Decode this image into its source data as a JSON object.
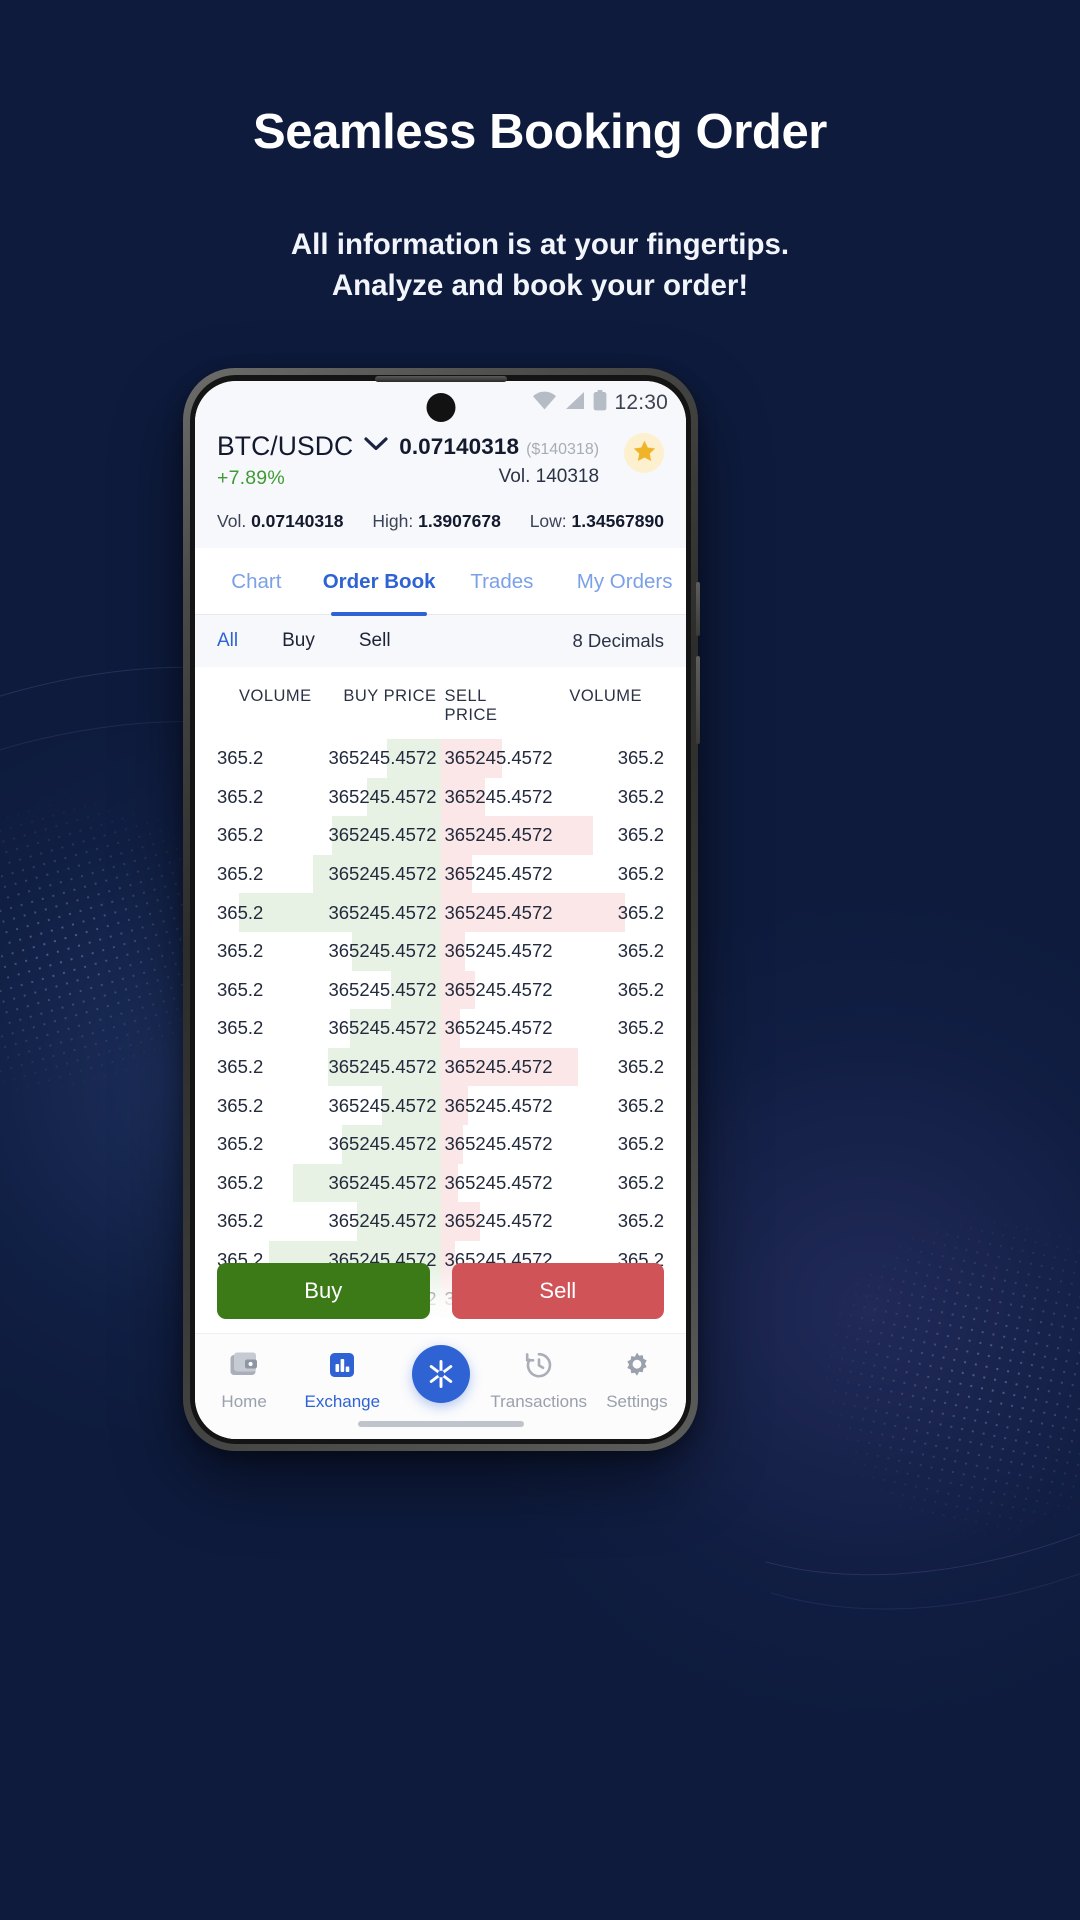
{
  "promo": {
    "title": "Seamless Booking Order",
    "subtitle_line1": "All information is at your fingertips.",
    "subtitle_line2": "Analyze and book your order!"
  },
  "colors": {
    "accent": "#2f63d4",
    "buy_green": "#3c7a17",
    "sell_red": "#d05457",
    "change_green": "#3f9c35",
    "depth_buy": "#e7f2e4",
    "depth_sell": "#fbe7e7",
    "star_bg": "#fdf0cf",
    "star": "#f0b429"
  },
  "statusbar": {
    "time": "12:30",
    "icons": [
      "wifi-icon",
      "signal-icon",
      "battery-icon"
    ]
  },
  "ticker": {
    "pair": "BTC/USDC",
    "dropdown_icon": "chevron-down-icon",
    "change": "+7.89%",
    "price": "0.07140318",
    "price_usd": "($140318)",
    "volume_inline": "Vol. 140318",
    "favorite_icon": "star-icon",
    "stats": [
      {
        "label": "Vol.",
        "value": "0.07140318"
      },
      {
        "label": "High:",
        "value": "1.3907678"
      },
      {
        "label": "Low:",
        "value": "1.34567890"
      }
    ]
  },
  "tabs": [
    {
      "label": "Chart",
      "active": false
    },
    {
      "label": "Order Book",
      "active": true
    },
    {
      "label": "Trades",
      "active": false
    },
    {
      "label": "My Orders",
      "active": false
    }
  ],
  "filters": {
    "options": [
      {
        "label": "All",
        "active": true
      },
      {
        "label": "Buy",
        "active": false
      },
      {
        "label": "Sell",
        "active": false
      }
    ],
    "decimals": "8 Decimals"
  },
  "orderbook": {
    "headers": [
      "VOLUME",
      "BUY PRICE",
      "SELL PRICE",
      "VOLUME"
    ],
    "rows": [
      {
        "buy_volume": "365.2",
        "buy_price": "365245.4572",
        "sell_price": "365245.4572",
        "sell_volume": "365.2",
        "buy_depth": 22,
        "sell_depth": 25
      },
      {
        "buy_volume": "365.2",
        "buy_price": "365245.4572",
        "sell_price": "365245.4572",
        "sell_volume": "365.2",
        "buy_depth": 30,
        "sell_depth": 18
      },
      {
        "buy_volume": "365.2",
        "buy_price": "365245.4572",
        "sell_price": "365245.4572",
        "sell_volume": "365.2",
        "buy_depth": 44,
        "sell_depth": 62
      },
      {
        "buy_volume": "365.2",
        "buy_price": "365245.4572",
        "sell_price": "365245.4572",
        "sell_volume": "365.2",
        "buy_depth": 52,
        "sell_depth": 13
      },
      {
        "buy_volume": "365.2",
        "buy_price": "365245.4572",
        "sell_price": "365245.4572",
        "sell_volume": "365.2",
        "buy_depth": 82,
        "sell_depth": 75
      },
      {
        "buy_volume": "365.2",
        "buy_price": "365245.4572",
        "sell_price": "365245.4572",
        "sell_volume": "365.2",
        "buy_depth": 36,
        "sell_depth": 10
      },
      {
        "buy_volume": "365.2",
        "buy_price": "365245.4572",
        "sell_price": "365245.4572",
        "sell_volume": "365.2",
        "buy_depth": 20,
        "sell_depth": 14
      },
      {
        "buy_volume": "365.2",
        "buy_price": "365245.4572",
        "sell_price": "365245.4572",
        "sell_volume": "365.2",
        "buy_depth": 37,
        "sell_depth": 8
      },
      {
        "buy_volume": "365.2",
        "buy_price": "365245.4572",
        "sell_price": "365245.4572",
        "sell_volume": "365.2",
        "buy_depth": 46,
        "sell_depth": 56
      },
      {
        "buy_volume": "365.2",
        "buy_price": "365245.4572",
        "sell_price": "365245.4572",
        "sell_volume": "365.2",
        "buy_depth": 24,
        "sell_depth": 11
      },
      {
        "buy_volume": "365.2",
        "buy_price": "365245.4572",
        "sell_price": "365245.4572",
        "sell_volume": "365.2",
        "buy_depth": 40,
        "sell_depth": 9
      },
      {
        "buy_volume": "365.2",
        "buy_price": "365245.4572",
        "sell_price": "365245.4572",
        "sell_volume": "365.2",
        "buy_depth": 60,
        "sell_depth": 7
      },
      {
        "buy_volume": "365.2",
        "buy_price": "365245.4572",
        "sell_price": "365245.4572",
        "sell_volume": "365.2",
        "buy_depth": 34,
        "sell_depth": 16
      },
      {
        "buy_volume": "365.2",
        "buy_price": "365245.4572",
        "sell_price": "365245.4572",
        "sell_volume": "365.2",
        "buy_depth": 70,
        "sell_depth": 6
      },
      {
        "buy_volume": "365.2",
        "buy_price": "365245.4572",
        "sell_price": "365245.4572",
        "sell_volume": "365.2",
        "buy_depth": 55,
        "sell_depth": 5
      }
    ]
  },
  "actions": {
    "buy_label": "Buy",
    "sell_label": "Sell"
  },
  "nav": [
    {
      "label": "Home",
      "icon": "wallet-icon",
      "active": false
    },
    {
      "label": "Exchange",
      "icon": "bar-chart-icon",
      "active": true
    },
    {
      "label": "",
      "icon": "swap-fab-icon",
      "active": false
    },
    {
      "label": "Transactions",
      "icon": "history-icon",
      "active": false
    },
    {
      "label": "Settings",
      "icon": "gear-icon",
      "active": false
    }
  ]
}
